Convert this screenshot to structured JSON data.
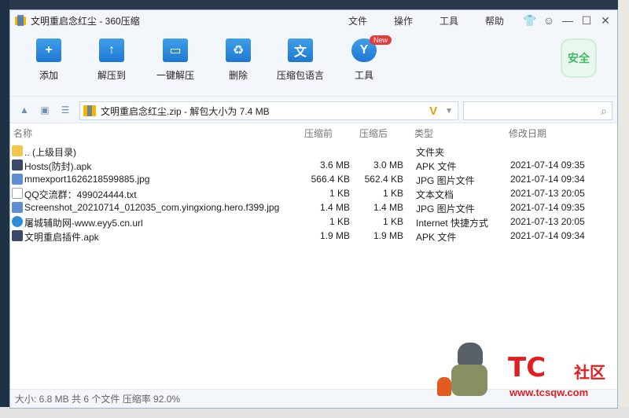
{
  "window": {
    "title": "文明重启念红尘 - 360压缩",
    "menu": [
      "文件",
      "操作",
      "工具",
      "帮助"
    ]
  },
  "toolbar": {
    "items": [
      {
        "label": "添加",
        "icon": "add-icon"
      },
      {
        "label": "解压到",
        "icon": "extract-to-icon"
      },
      {
        "label": "一键解压",
        "icon": "one-click-extract-icon"
      },
      {
        "label": "删除",
        "icon": "delete-icon"
      },
      {
        "label": "压缩包语言",
        "icon": "archive-language-icon"
      },
      {
        "label": "工具",
        "icon": "tools-icon"
      }
    ],
    "new_badge": "New",
    "safe_badge": "安全"
  },
  "address": {
    "path": "文明重启念红尘.zip - 解包大小为 7.4 MB"
  },
  "columns": {
    "name": "名称",
    "pre": "压缩前",
    "post": "压缩后",
    "type": "类型",
    "date": "修改日期"
  },
  "files": [
    {
      "name": ".. (上级目录)",
      "pre": "",
      "post": "",
      "type": "文件夹",
      "date": "",
      "icon": "folder"
    },
    {
      "name": "Hosts(防封).apk",
      "pre": "3.6 MB",
      "post": "3.0 MB",
      "type": "APK 文件",
      "date": "2021-07-14 09:35",
      "icon": "apk"
    },
    {
      "name": "mmexport1626218599885.jpg",
      "pre": "566.4 KB",
      "post": "562.4 KB",
      "type": "JPG 图片文件",
      "date": "2021-07-14 09:34",
      "icon": "jpg"
    },
    {
      "name": "QQ交流群：499024444.txt",
      "pre": "1 KB",
      "post": "1 KB",
      "type": "文本文档",
      "date": "2021-07-13 20:05",
      "icon": "txt"
    },
    {
      "name": "Screenshot_20210714_012035_com.yingxiong.hero.f399.jpg",
      "pre": "1.4 MB",
      "post": "1.4 MB",
      "type": "JPG 图片文件",
      "date": "2021-07-14 09:35",
      "icon": "jpg"
    },
    {
      "name": "屠城辅助网-www.eyy5.cn.url",
      "pre": "1 KB",
      "post": "1 KB",
      "type": "Internet 快捷方式",
      "date": "2021-07-13 20:05",
      "icon": "url"
    },
    {
      "name": "文明重启插件.apk",
      "pre": "1.9 MB",
      "post": "1.9 MB",
      "type": "APK 文件",
      "date": "2021-07-14 09:34",
      "icon": "apk"
    }
  ],
  "status": "大小: 6.8 MB 共 6 个文件 压缩率 92.0%",
  "watermark": {
    "logo": "TC",
    "area": "社区",
    "url": "www.tcsqw.com"
  }
}
